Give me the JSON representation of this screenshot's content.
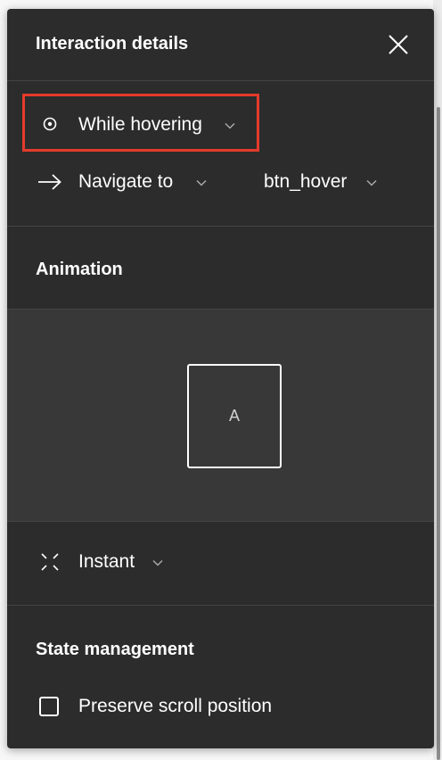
{
  "panel": {
    "title": "Interaction details"
  },
  "trigger": {
    "label": "While hovering",
    "icon": "hover-trigger-icon",
    "highlight_color": "#e53b2c"
  },
  "action": {
    "label": "Navigate to",
    "icon": "arrow-right-icon",
    "destination": "btn_hover"
  },
  "animation": {
    "section_title": "Animation",
    "preview_frame_label": "A",
    "transition_label": "Instant",
    "transition_icon": "instant-transition-icon"
  },
  "state_management": {
    "section_title": "State management",
    "preserve_scroll_label": "Preserve scroll position",
    "preserve_scroll_checked": false
  },
  "colors": {
    "panel_background": "#2c2c2c",
    "preview_background": "#383838",
    "divider": "#444444",
    "text": "#ffffff"
  }
}
